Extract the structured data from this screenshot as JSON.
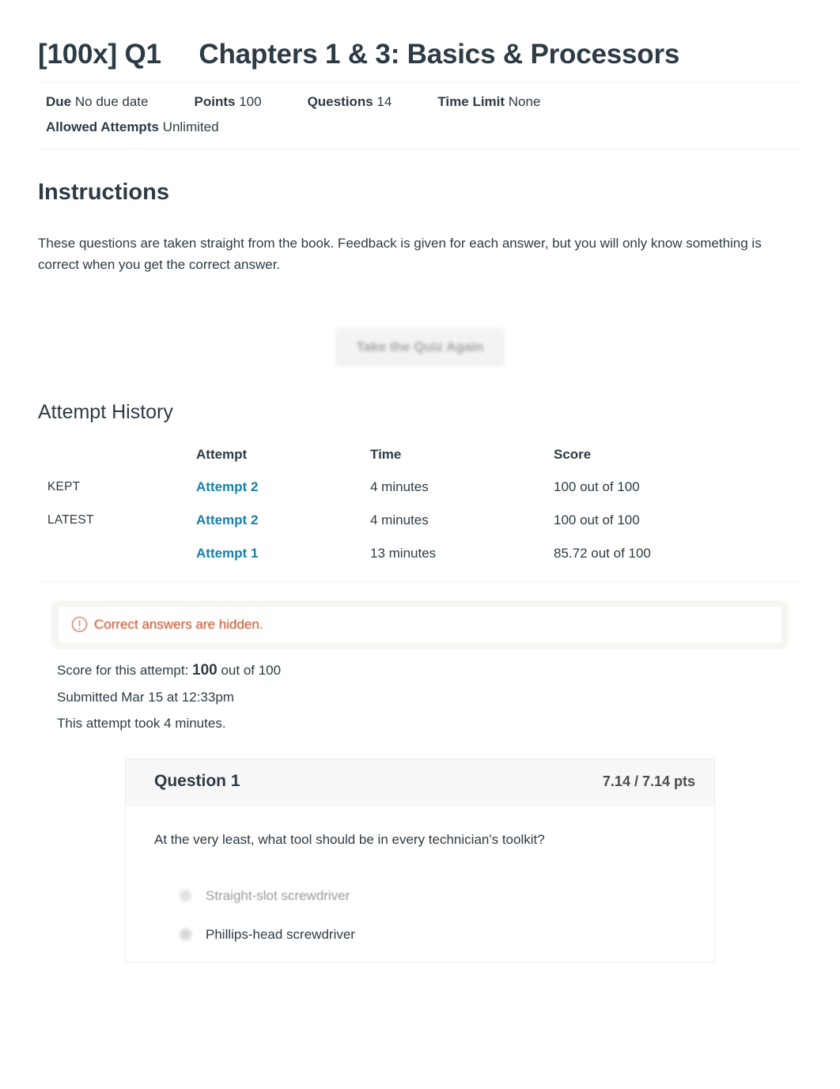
{
  "quiz": {
    "title": "[100x] Q1     Chapters 1 & 3: Basics & Processors",
    "meta": {
      "due_label": "Due",
      "due_value": "No due date",
      "points_label": "Points",
      "points_value": "100",
      "questions_label": "Questions",
      "questions_value": "14",
      "time_limit_label": "Time Limit",
      "time_limit_value": "None",
      "allowed_attempts_label": "Allowed Attempts",
      "allowed_attempts_value": "Unlimited"
    }
  },
  "instructions": {
    "heading": "Instructions",
    "body": "These questions are taken straight from the book. Feedback is given for each answer, but you will only know something is correct when you get the correct answer."
  },
  "actions": {
    "take_quiz_again": "Take the Quiz Again"
  },
  "attempt_history": {
    "heading": "Attempt History",
    "columns": {
      "status": "",
      "attempt": "Attempt",
      "time": "Time",
      "score": "Score"
    },
    "rows": [
      {
        "status": "KEPT",
        "attempt": "Attempt 2",
        "time": "4 minutes",
        "score": "100 out of 100"
      },
      {
        "status": "LATEST",
        "attempt": "Attempt 2",
        "time": "4 minutes",
        "score": "100 out of 100"
      },
      {
        "status": "",
        "attempt": "Attempt 1",
        "time": "13 minutes",
        "score": "85.72 out of 100"
      }
    ]
  },
  "alert": {
    "icon": "warning-circle-icon",
    "text": "Correct answers are hidden.",
    "color": "#c5451d"
  },
  "attempt_summary": {
    "score_prefix": "Score for this attempt:",
    "score_value": "100",
    "score_suffix": "out of 100",
    "submitted": "Submitted Mar 15 at 12:33pm",
    "duration": "This attempt took 4 minutes."
  },
  "question": {
    "name": "Question 1",
    "points": "7.14 / 7.14 pts",
    "text": "At the very least, what tool should be in every technician's toolkit?",
    "answers": [
      {
        "label": "Straight-slot screwdriver",
        "selected": false,
        "faded": true
      },
      {
        "label": "Phillips-head screwdriver",
        "selected": false,
        "faded": false
      }
    ]
  },
  "colors": {
    "link_blue": "#1a7fa8",
    "text": "#2d3b45",
    "alert_red": "#c5451d",
    "header_band": "#f7f7f7"
  }
}
